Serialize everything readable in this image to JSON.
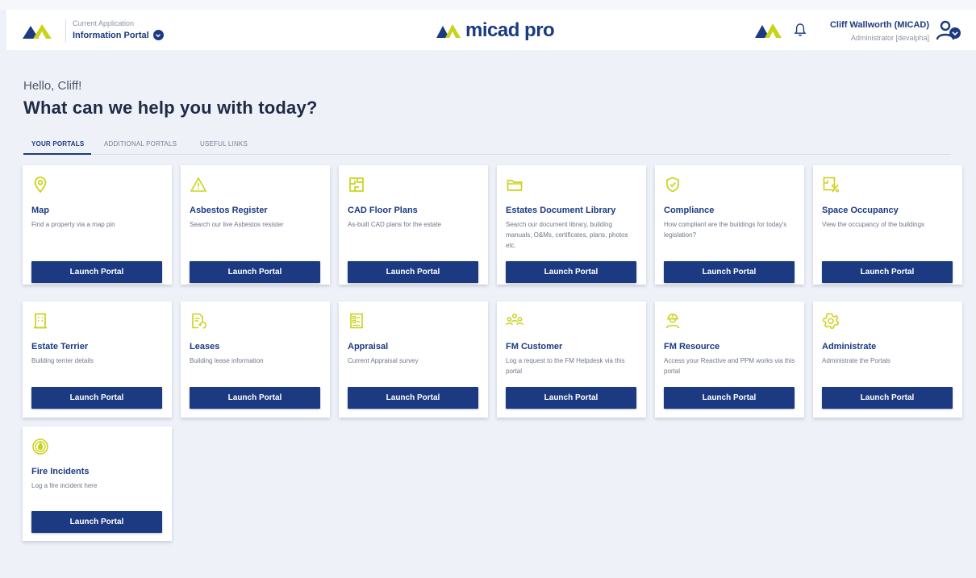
{
  "header": {
    "app_caption": "Current Application",
    "app_name": "Information Portal",
    "brand": "micad pro",
    "user_name": "Cliff Wallworth (MICAD)",
    "user_role": "Administrator [devalpha]"
  },
  "greeting": "Hello, Cliff!",
  "headline": "What can we help you with today?",
  "tabs": [
    {
      "label": "YOUR PORTALS",
      "active": true
    },
    {
      "label": "ADDITIONAL PORTALS",
      "active": false
    },
    {
      "label": "USEFUL LINKS",
      "active": false
    }
  ],
  "launch_label": "Launch Portal",
  "colors": {
    "brand": "#1b3a82",
    "accent": "#c9d31c",
    "background": "#eef1f8"
  },
  "portals": [
    {
      "title": "Map",
      "desc": "Find a property via a map pin",
      "icon": "map-pin-icon"
    },
    {
      "title": "Asbestos Register",
      "desc": "Search our live Asbestos resister",
      "icon": "warning-triangle-icon"
    },
    {
      "title": "CAD Floor Plans",
      "desc": "As-built CAD plans for the estate",
      "icon": "floor-plan-icon"
    },
    {
      "title": "Estates Document Library",
      "desc": "Search our document library, building manuals, O&Ms, certificates, plans, photos etc.",
      "icon": "folder-icon"
    },
    {
      "title": "Compliance",
      "desc": "How compliant are the buildings for today's legislation?",
      "icon": "shield-check-icon"
    },
    {
      "title": "Space Occupancy",
      "desc": "View the occupancy of the buildings",
      "icon": "occupancy-icon"
    },
    {
      "title": "Estate Terrier",
      "desc": "Building terrier details",
      "icon": "building-icon"
    },
    {
      "title": "Leases",
      "desc": "Building lease information",
      "icon": "lease-document-icon"
    },
    {
      "title": "Appraisal",
      "desc": "Current Appraisal survey",
      "icon": "clipboard-icon"
    },
    {
      "title": "FM Customer",
      "desc": "Log a request to the FM Helpdesk via this portal",
      "icon": "people-group-icon"
    },
    {
      "title": "FM Resource",
      "desc": "Access your Reactive and PPM works via this portal",
      "icon": "hard-hat-worker-icon"
    },
    {
      "title": "Administrate",
      "desc": "Administrate the Portals",
      "icon": "gear-icon"
    },
    {
      "title": "Fire Incidents",
      "desc": "Log a fire incident here",
      "icon": "fire-icon"
    }
  ]
}
